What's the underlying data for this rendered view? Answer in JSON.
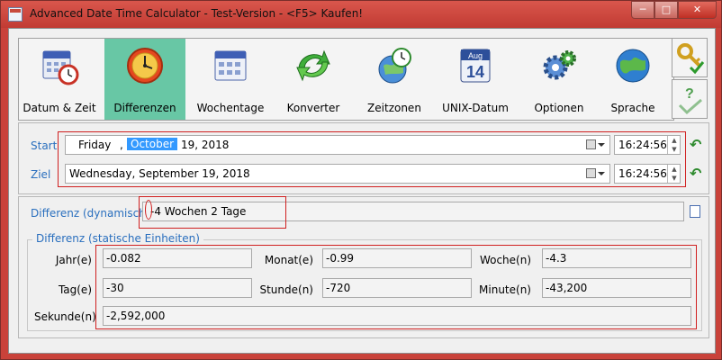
{
  "window": {
    "title": "Advanced Date Time Calculator - Test-Version - <F5> Kaufen!",
    "min_glyph": "─",
    "max_glyph": "□",
    "close_glyph": "✕"
  },
  "toolbar": {
    "items": [
      {
        "label": "Datum & Zeit",
        "icon": "calendar-clock-icon"
      },
      {
        "label": "Differenzen",
        "icon": "clock-icon",
        "active": true
      },
      {
        "label": "Wochentage",
        "icon": "calendar-icon"
      },
      {
        "label": "Konverter",
        "icon": "convert-arrows-icon"
      },
      {
        "label": "Zeitzonen",
        "icon": "globe-clock-icon"
      },
      {
        "label": "UNIX-Datum",
        "icon": "calendar-day-icon",
        "icon_month": "Aug",
        "icon_day": "14"
      },
      {
        "label": "Optionen",
        "icon": "gears-icon"
      },
      {
        "label": "Sprache",
        "icon": "globe-icon"
      }
    ],
    "side_buttons": [
      {
        "icon": "key-check-icon"
      },
      {
        "icon": "help-check-icon"
      }
    ]
  },
  "start": {
    "label": "Start",
    "weekday": "Friday",
    "sep": ",",
    "month": "October",
    "rest": "19, 2018",
    "time": "16:24:56"
  },
  "ziel": {
    "label": "Ziel",
    "date": "Wednesday, September 19, 2018",
    "time": "16:24:56"
  },
  "difference": {
    "label": "Differenz (dynamisch)",
    "value": "-4 Wochen 2 Tage"
  },
  "static": {
    "title": "Differenz (statische Einheiten)",
    "fields": {
      "jahr": {
        "label": "Jahr(e)",
        "value": "-0.082"
      },
      "monat": {
        "label": "Monat(e)",
        "value": "-0.99"
      },
      "woche": {
        "label": "Woche(n)",
        "value": "-4.3"
      },
      "tag": {
        "label": "Tag(e)",
        "value": "-30"
      },
      "stunde": {
        "label": "Stunde(n)",
        "value": "-720"
      },
      "minute": {
        "label": "Minute(n)",
        "value": "-43,200"
      },
      "sekunde": {
        "label": "Sekunde(n)",
        "value": "-2,592,000"
      }
    }
  },
  "colors": {
    "title_bar": "#c9423a",
    "active_tab": "#68c7a5",
    "label_blue": "#2a6fbe",
    "annotation_red": "#d02020"
  }
}
